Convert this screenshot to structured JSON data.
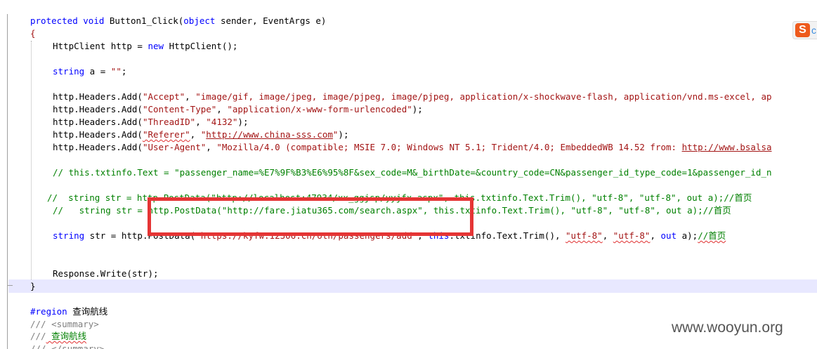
{
  "code": {
    "l1": {
      "kw1": "protected",
      "kw2": "void",
      "name": "Button1_Click(",
      "kw3": "object",
      "rest": " sender, EventArgs e)"
    },
    "l2": "{",
    "l3": {
      "a": "HttpClient http = ",
      "kw": "new",
      "b": " HttpClient();"
    },
    "l4": {
      "kw": "string",
      "a": " a = ",
      "s": "\"\"",
      "b": ";"
    },
    "h1": {
      "a": "http.Headers.Add(",
      "s1": "\"Accept\"",
      "b": ", ",
      "s2": "\"image/gif, image/jpeg, image/pjpeg, image/pjpeg, application/x-shockwave-flash, application/vnd.ms-excel, ap"
    },
    "h2": {
      "a": "http.Headers.Add(",
      "s1": "\"Content-Type\"",
      "b": ", ",
      "s2": "\"application/x-www-form-urlencoded\"",
      "c": ");"
    },
    "h3": {
      "a": "http.Headers.Add(",
      "s1": "\"ThreadID\"",
      "b": ", ",
      "s2": "\"4132\"",
      "c": ");"
    },
    "h4": {
      "a": "http.Headers.Add(",
      "s1": "\"Referer\"",
      "b": ", ",
      "s2a": "\"",
      "url": "http://www.china-sss.com",
      "s2b": "\"",
      "c": ");"
    },
    "h5": {
      "a": "http.Headers.Add(",
      "s1": "\"User-Agent\"",
      "b": ", ",
      "s2": "\"Mozilla/4.0 (compatible; MSIE 7.0; Windows NT 5.1; Trident/4.0; EmbeddedWB 14.52 from: ",
      "url": "http://www.bsalsa"
    },
    "c1": "// this.txtinfo.Text = \"passenger_name=%E7%9F%B3%E6%95%8F&sex_code=M&_birthDate=&country_code=CN&passenger_id_type_code=1&passenger_id_n",
    "c2": "//  string str = http.PostData(\"http://localhost:47934/xx_ggjsp/yyjfx.aspx\", this.txtinfo.Text.Trim(), \"utf-8\", \"utf-8\", out a);//首页",
    "c3": "//   string str = http.PostData(\"http://fare.jiatu365.com/search.aspx\", this.txtinfo.Text.Trim(), \"utf-8\", \"utf-8\", out a);//首页",
    "l5": {
      "kw": "string",
      "a": " str = http.PostData(",
      "s1": "\"https://kyfw.12306.cn/otn/passengers/add\"",
      "b": ", ",
      "kw2": "this",
      "c": ".txtinfo.Text.Trim(), ",
      "s2": "\"utf-8\"",
      "d": ", ",
      "s3": "\"utf-8\"",
      "e": ", ",
      "kw3": "out",
      "f": " a);",
      "cm": "//首页"
    },
    "l6": "Response.Write(str);",
    "l7": "}",
    "region": {
      "kw": "#region",
      "text": " 查询航线"
    },
    "doc1": {
      "slashes": "///",
      "tag": " <summary>"
    },
    "doc2": {
      "slashes": "///",
      "text": " 查询航线"
    },
    "doc3": {
      "slashes": "///",
      "tag": " </summary>"
    }
  },
  "overlay": {
    "sogou_letter": "S",
    "sogou_extra": "c"
  },
  "watermark": "www.wooyun.org",
  "colors": {
    "keyword": "#0000ff",
    "string": "#a31515",
    "comment": "#008000",
    "highlight_box": "#e53535",
    "current_line": "#e8e8ff"
  }
}
